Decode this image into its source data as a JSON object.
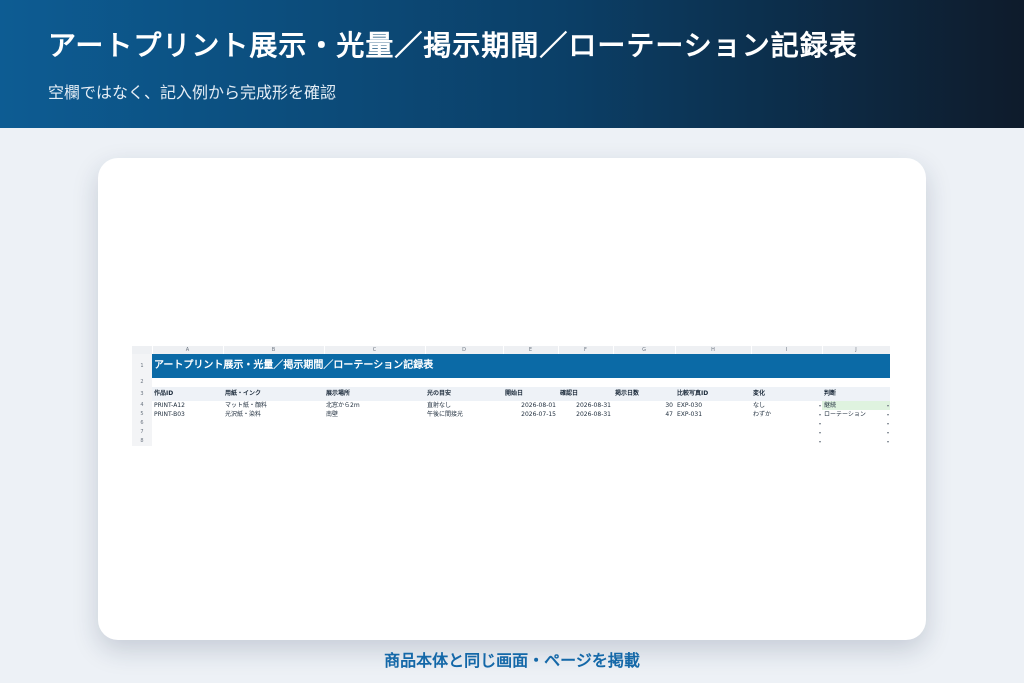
{
  "hero": {
    "title": "アートプリント展示・光量／掲示期間／ローテーション記録表",
    "subtitle": "空欄ではなく、記入例から完成形を確認"
  },
  "sheet": {
    "columns": [
      "A",
      "B",
      "C",
      "D",
      "E",
      "F",
      "G",
      "H",
      "I",
      "J"
    ],
    "row_numbers": [
      "1",
      "2",
      "3",
      "4",
      "5",
      "6",
      "7",
      "8"
    ],
    "title": "アートプリント展示・光量／掲示期間／ローテーション記録表",
    "headers": [
      "作品ID",
      "用紙・インク",
      "展示場所",
      "光の目安",
      "開始日",
      "確認日",
      "掲示日数",
      "比較写真ID",
      "変化",
      "判断"
    ],
    "rows": [
      {
        "id": "PRINT-A12",
        "paper": "マット紙・顔料",
        "place": "北窓から2m",
        "light": "直射なし",
        "start": "2026-08-01",
        "check": "2026-08-31",
        "days": "30",
        "photo": "EXP-030",
        "change": "なし",
        "decision": "継続"
      },
      {
        "id": "PRINT-B03",
        "paper": "光沢紙・染料",
        "place": "南壁",
        "light": "午後に間接光",
        "start": "2026-07-15",
        "check": "2026-08-31",
        "days": "47",
        "photo": "EXP-031",
        "change": "わずか",
        "decision": "ローテーション"
      }
    ],
    "dropdown_glyph": "▾"
  },
  "caption": "商品本体と同じ画面・ページを掲載",
  "colors": {
    "accent": "#0b6aa6",
    "caption": "#1468a8",
    "highlight": "#dff3df"
  }
}
